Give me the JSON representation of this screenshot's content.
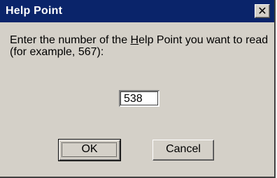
{
  "window": {
    "title": "Help Point",
    "close_symbol": "✕",
    "close_icon": "close-icon"
  },
  "prompt": {
    "part1": "Enter the number of the ",
    "underlined": "H",
    "part2": "elp Point you want to read (for example, 567):"
  },
  "input": {
    "value": "538"
  },
  "buttons": {
    "ok_label": "OK",
    "cancel_label": "Cancel"
  },
  "colors": {
    "titlebar": "#0a246a",
    "face": "#d4d0c8"
  }
}
